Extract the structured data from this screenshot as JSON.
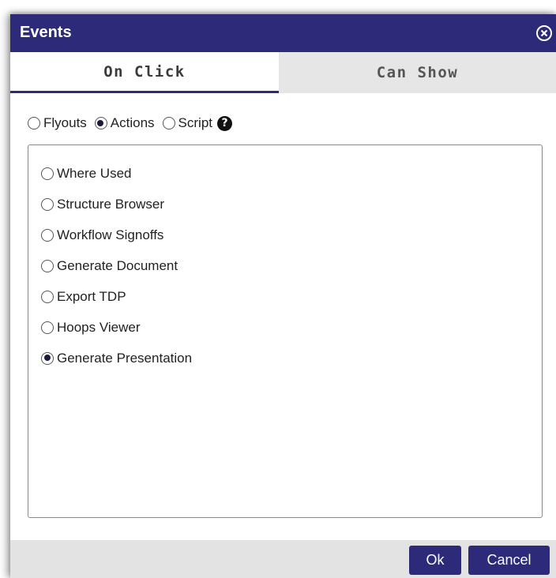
{
  "dialog": {
    "title": "Events",
    "close_icon": "close-circle-icon"
  },
  "tabs": [
    {
      "label": "On Click",
      "active": true
    },
    {
      "label": "Can Show",
      "active": false
    }
  ],
  "modes": [
    {
      "label": "Flyouts",
      "checked": false
    },
    {
      "label": "Actions",
      "checked": true
    },
    {
      "label": "Script",
      "checked": false
    }
  ],
  "help_icon": {
    "glyph": "?",
    "name": "help-icon"
  },
  "actions": [
    {
      "label": "Where Used",
      "checked": false
    },
    {
      "label": "Structure Browser",
      "checked": false
    },
    {
      "label": "Workflow Signoffs",
      "checked": false
    },
    {
      "label": "Generate Document",
      "checked": false
    },
    {
      "label": "Export TDP",
      "checked": false
    },
    {
      "label": "Hoops Viewer",
      "checked": false
    },
    {
      "label": "Generate Presentation",
      "checked": true
    }
  ],
  "footer": {
    "ok_label": "Ok",
    "cancel_label": "Cancel"
  },
  "colors": {
    "accent": "#2e2a7a",
    "tab_bar": "#e6e6e6",
    "footer": "#e3e3e3"
  }
}
